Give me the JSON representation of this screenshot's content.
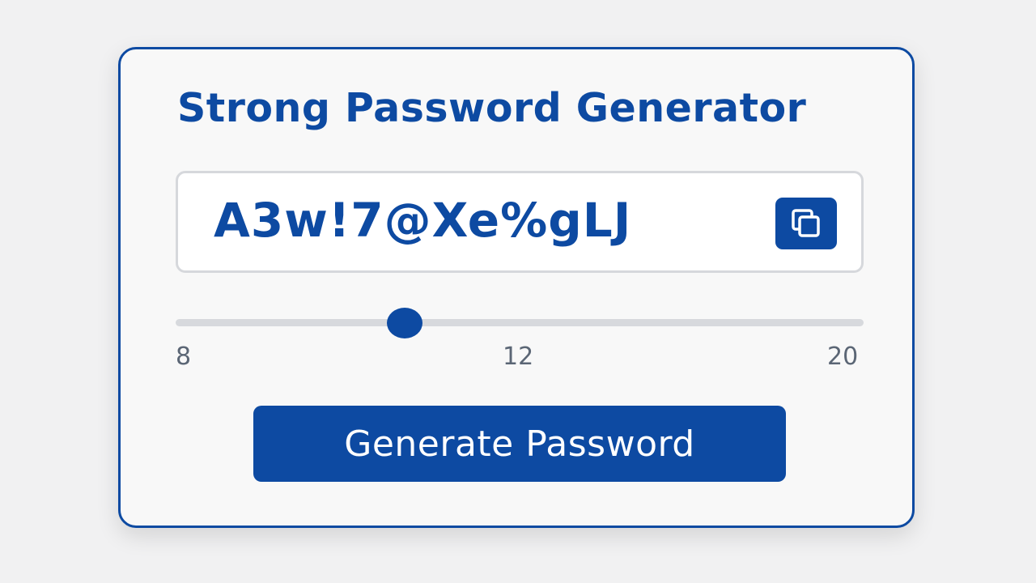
{
  "title": "Strong Password Generator",
  "password": {
    "value": "A3w!7@Xe%gLJ",
    "copy_icon": "copy-icon"
  },
  "length_slider": {
    "min": 8,
    "max": 20,
    "value": 12,
    "min_label": "8",
    "mid_label": "12",
    "max_label": "20"
  },
  "generate_button_label": "Generate Password",
  "colors": {
    "accent": "#0d4aa2",
    "background": "#f1f1f2",
    "card": "#f8f8f8",
    "track": "#d7d9dd",
    "tick_text": "#5b6675"
  }
}
